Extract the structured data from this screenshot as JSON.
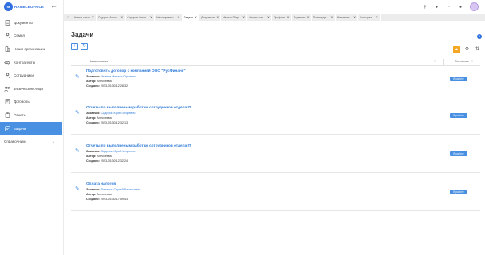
{
  "app": {
    "logo_text": "RAMBLEOFFICE",
    "logo_mark": "ra"
  },
  "sidebar": {
    "items": [
      {
        "label": "Документы",
        "icon": "document-icon"
      },
      {
        "label": "Семья",
        "icon": "person-icon"
      },
      {
        "label": "Наши организации",
        "icon": "building-icon"
      },
      {
        "label": "Контрагенты",
        "icon": "handshake-icon"
      },
      {
        "label": "Сотрудники",
        "icon": "person-icon"
      },
      {
        "label": "Физические лица",
        "icon": "people-icon"
      },
      {
        "label": "Договоры",
        "icon": "contract-icon"
      },
      {
        "label": "Отчеты",
        "icon": "report-icon"
      },
      {
        "label": "Задачи",
        "icon": "task-icon",
        "active": true
      },
      {
        "label": "Справочники",
        "icon": "none",
        "has_chevron": true
      }
    ]
  },
  "tabs": [
    {
      "label": "Новые связи"
    },
    {
      "label": "Сидоров Антон..."
    },
    {
      "label": "Сидоров Антон..."
    },
    {
      "label": "Наши организ..."
    },
    {
      "label": "Задачи",
      "active": true
    },
    {
      "label": "Документы"
    },
    {
      "label": "Иванов Пётр..."
    },
    {
      "label": "Отчеты сар..."
    },
    {
      "label": "Профиль"
    },
    {
      "label": "Подписки"
    },
    {
      "label": "Попподарь..."
    },
    {
      "label": "Маркетинг..."
    },
    {
      "label": "Кольцова..."
    }
  ],
  "page": {
    "title": "Задачи",
    "help": "?",
    "add": "+",
    "refresh": "↻"
  },
  "table": {
    "col_name": "Наименование",
    "col_status": "Состояние",
    "q": "?",
    "rows": [
      {
        "title": "Подготовить договор с компанией ООО \"РусФинанс\"",
        "customer_label": "Заказчик:",
        "customer": "Иванов Михаил Юрьевич",
        "author_label": "Автор:",
        "author": "Алексеева",
        "created_label": "Создано:",
        "created": "2023-05-30 12:28:32",
        "status": "В работе"
      },
      {
        "title": "Отчеты по выполненым работам сотрудников отдела IT",
        "customer_label": "Заказчик:",
        "customer": "Сидоров Юрий Игоревич",
        "author_label": "Автор:",
        "author": "Алексеева",
        "created_label": "Создано:",
        "created": "2023-05-30 12:32:13",
        "status": "В работе"
      },
      {
        "title": "Отчеты по выполненым работам сотрудников отдела IT",
        "customer_label": "Заказчик:",
        "customer": "Сидоров Юрий Игоревич",
        "author_label": "Автор:",
        "author": "Алексеева",
        "created_label": "Создано:",
        "created": "2023-05-30 12:32:24",
        "status": "В работе"
      },
      {
        "title": "Оплата налогов",
        "customer_label": "Заказчик:",
        "customer": "Романов Сергей Васильевич",
        "author_label": "Автор:",
        "author": "Алексеева",
        "created_label": "Создано:",
        "created": "2023-05-30 17:59:43",
        "status": "В работе"
      }
    ]
  },
  "colors": {
    "accent": "#4a90e2",
    "link": "#2f7bd8",
    "warning": "#f5a623",
    "avatar": "#d8c6f2"
  }
}
